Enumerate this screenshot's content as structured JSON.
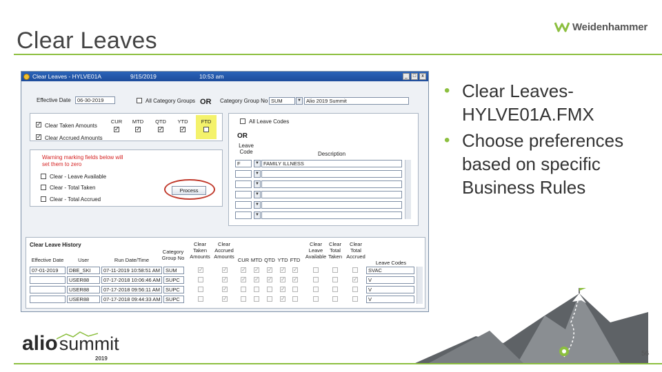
{
  "slide": {
    "title": "Clear Leaves",
    "brand": "Weidenhammer",
    "bullets": [
      "Clear Leaves-HYLVE01A.FMX",
      "Choose preferences based on specific Business Rules"
    ],
    "page_number": "56",
    "event_logo": {
      "a": "alio",
      "summit": "summit",
      "year": "2019"
    }
  },
  "colors": {
    "accent": "#8cbf3f",
    "titlebar": "#2b63b8",
    "highlight": "#f4f26b",
    "annotation_ring": "#c0392b"
  },
  "window": {
    "title": "Clear Leaves - HYLVE01A",
    "date": "9/15/2019",
    "time": "10:53 am",
    "buttons": [
      "_",
      "□",
      "x"
    ]
  },
  "form": {
    "effective_date_label": "Effective Date",
    "effective_date_value": "06-30-2019",
    "all_category_groups_label": "All Category Groups",
    "or_label": "OR",
    "category_group_label": "Category Group No",
    "category_group_value": "SUM",
    "category_group_desc": "Alio 2019 Summit",
    "period_headers": [
      "CUR",
      "MTD",
      "QTD",
      "YTD",
      "FTD"
    ],
    "clear_taken_label": "Clear Taken Amounts",
    "clear_accrued_label": "Clear Accrued Amounts",
    "warning_text": "Warning marking fields below will set them to zero",
    "clear_options": [
      "Clear - Leave Available",
      "Clear - Total Taken",
      "Clear - Total Accrued"
    ],
    "process_label": "Process",
    "all_leave_codes_label": "All Leave Codes",
    "or2_label": "OR",
    "leave_code_header": "Leave Code",
    "description_header": "Description",
    "leave_code_value": "F",
    "leave_code_desc": "FAMILY ILLNESS"
  },
  "history": {
    "title": "Clear Leave History",
    "headers": {
      "effective_date": "Effective Date",
      "user": "User",
      "run_date": "Run Date/Time",
      "category": "Category Group No",
      "clear_taken": "Clear Taken Amounts",
      "clear_accrued": "Clear Accrued Amounts",
      "cur": "CUR",
      "mtd": "MTD",
      "qtd": "QTD",
      "ytd": "YTD",
      "ftd": "FTD",
      "clear_leave_avail": "Clear Leave Available",
      "clear_total_taken": "Clear Total Taken",
      "clear_total_accrued": "Clear Total Accrued",
      "leave_codes": "Leave Codes"
    },
    "rows": [
      {
        "effective_date": "07-01-2019",
        "user": "DBE_SKI",
        "run_date": "07-11-2019 10:58:51 AM",
        "category": "SUM",
        "leave_codes": "SVAC"
      },
      {
        "effective_date": "",
        "user": "USER88",
        "run_date": "07-17-2018 10:06:46 AM",
        "category": "SUPC",
        "leave_codes": "V"
      },
      {
        "effective_date": "",
        "user": "USER88",
        "run_date": "07-17-2018 09:56:11 AM",
        "category": "SUPC",
        "leave_codes": "V"
      },
      {
        "effective_date": "",
        "user": "USER88",
        "run_date": "07-17-2018 09:44:33 AM",
        "category": "SUPC",
        "leave_codes": "V"
      }
    ],
    "checkmark": "✓"
  }
}
